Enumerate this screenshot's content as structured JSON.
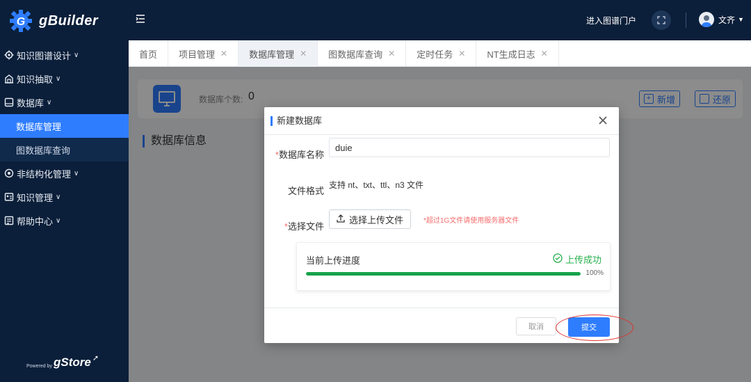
{
  "app": {
    "name": "gBuilder",
    "powered_by": "Powered by",
    "powered_brand": "gStore"
  },
  "colors": {
    "sidebar_bg": "#0b1f3a",
    "accent": "#2f7dff",
    "success": "#16a34a",
    "required": "#f56c6c"
  },
  "sidebar": {
    "items": [
      {
        "label": "知识图谱设计",
        "icon": "gear-icon"
      },
      {
        "label": "知识抽取",
        "icon": "building-icon"
      },
      {
        "label": "数据库",
        "icon": "database-icon"
      },
      {
        "label": "非结构化管理",
        "icon": "globe-icon"
      },
      {
        "label": "知识管理",
        "icon": "card-icon"
      },
      {
        "label": "帮助中心",
        "icon": "help-icon"
      }
    ],
    "subitems": [
      {
        "label": "数据库管理",
        "active": true
      },
      {
        "label": "图数据库查询",
        "active": false
      }
    ]
  },
  "header": {
    "portal_link": "进入图谱门户",
    "user_name": "文齐"
  },
  "tabs": [
    {
      "label": "首页",
      "closable": false
    },
    {
      "label": "项目管理",
      "closable": true
    },
    {
      "label": "数据库管理",
      "closable": true,
      "active": true
    },
    {
      "label": "图数据库查询",
      "closable": true
    },
    {
      "label": "定时任务",
      "closable": true
    },
    {
      "label": "NT生成日志",
      "closable": true
    }
  ],
  "main": {
    "count_label": "数据库个数:",
    "count_value": "0",
    "add_label": "新增",
    "restore_label": "还原",
    "section_title": "数据库信息"
  },
  "modal": {
    "title": "新建数据库",
    "name_label": "数据库名称",
    "name_value": "duie",
    "format_label": "文件格式",
    "format_text": "支持 nt、txt、ttl、n3 文件",
    "file_label": "选择文件",
    "upload_button": "选择上传文件",
    "upload_hint": "*超过1G文件请使用服务器文件",
    "progress_label": "当前上传进度",
    "progress_status": "上传成功",
    "progress_percent": 100,
    "progress_percent_text": "100%",
    "cancel_label": "取消",
    "submit_label": "提交"
  }
}
